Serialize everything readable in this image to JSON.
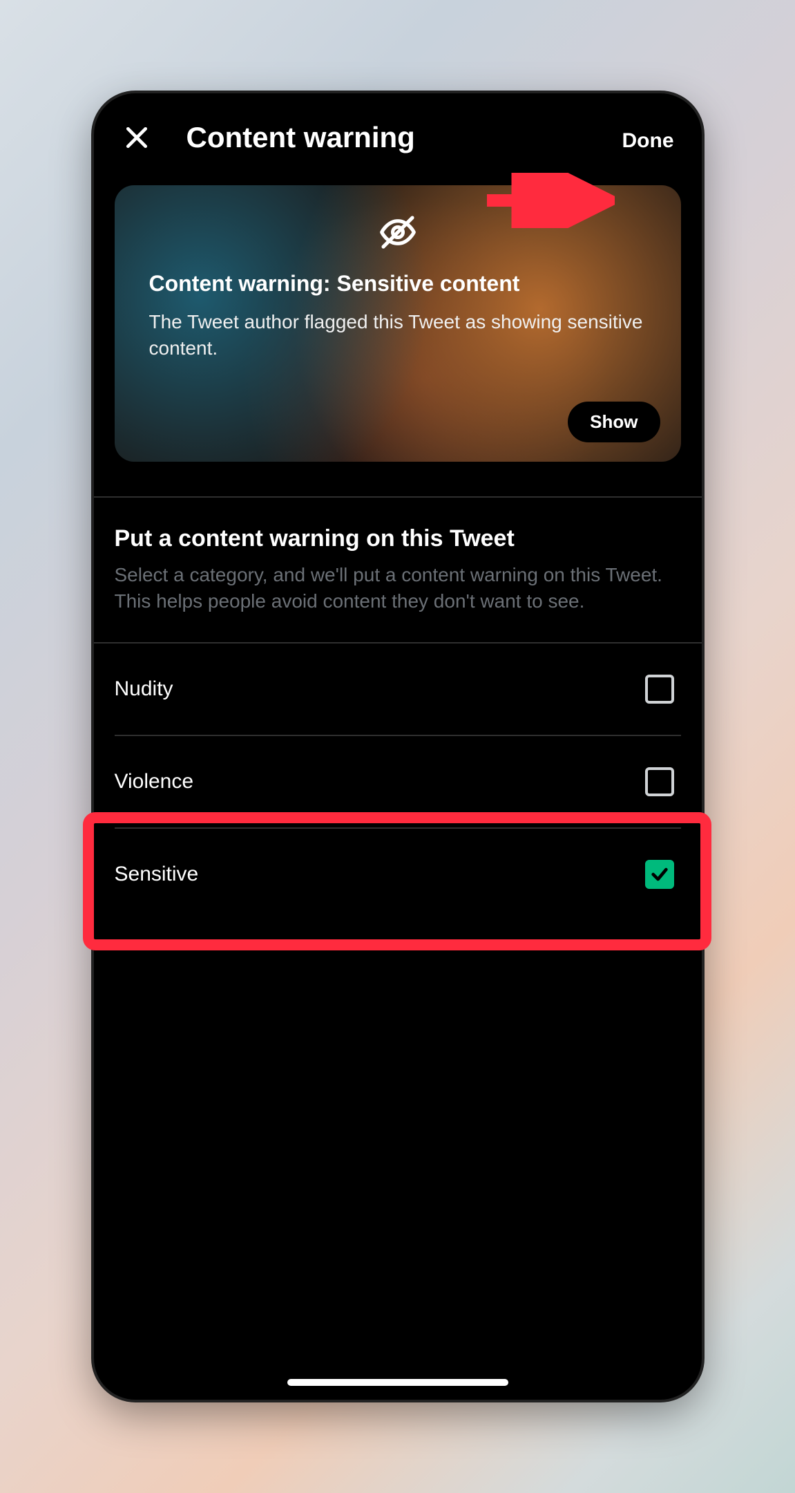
{
  "header": {
    "title": "Content warning",
    "done_label": "Done"
  },
  "preview": {
    "heading": "Content warning: Sensitive content",
    "body": "The Tweet author flagged this Tweet as showing sensitive content.",
    "show_label": "Show"
  },
  "section": {
    "heading": "Put a content warning on this Tweet",
    "body": "Select a category, and we'll put a content warning on this Tweet. This helps people avoid content they don't want to see."
  },
  "options": [
    {
      "label": "Nudity",
      "checked": false
    },
    {
      "label": "Violence",
      "checked": false
    },
    {
      "label": "Sensitive",
      "checked": true
    }
  ],
  "annotations": {
    "highlight_option_index": 2,
    "arrow_points_to": "done-button"
  },
  "colors": {
    "accent_green": "#00ba7c",
    "highlight_red": "#ff2b3e"
  }
}
